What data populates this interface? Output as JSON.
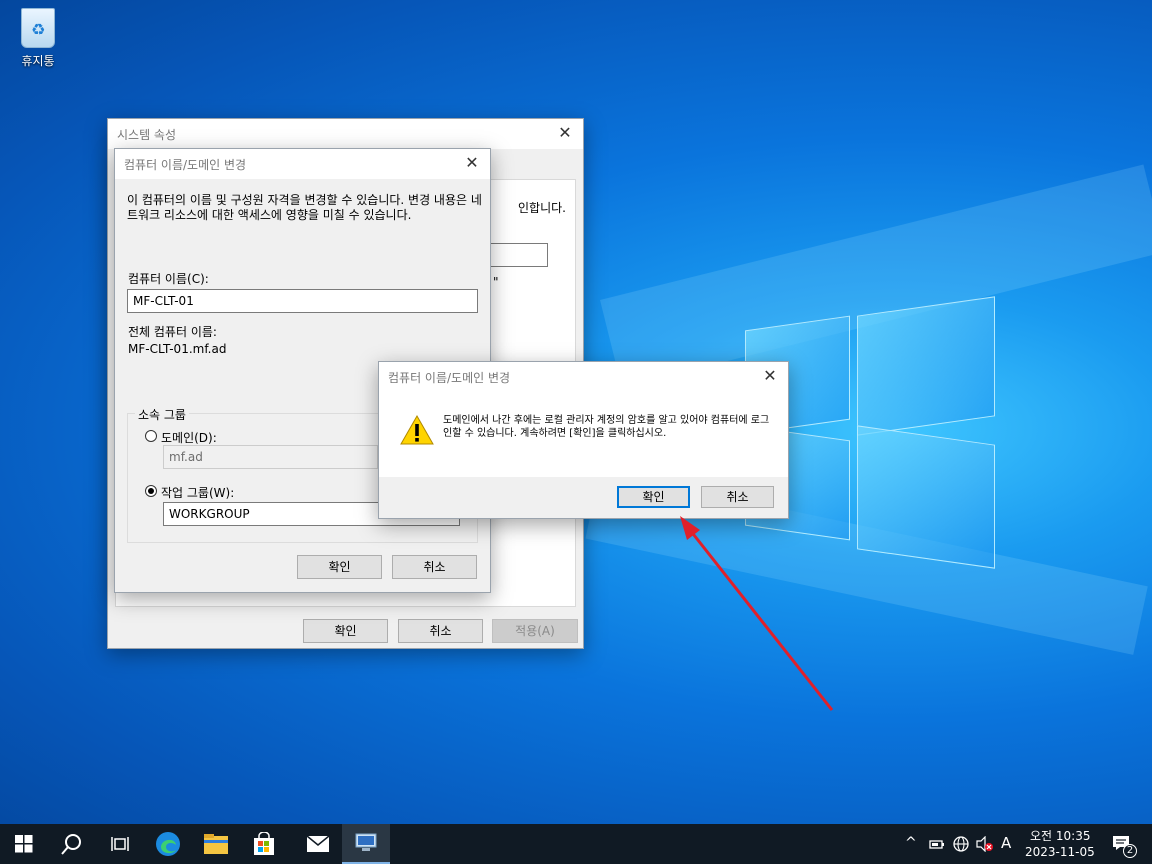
{
  "desktop": {
    "recycle_bin_label": "휴지통"
  },
  "sysprops": {
    "title": "시스템 속성",
    "partial_text_1": "인합니다.",
    "partial_text_2": "\"",
    "ok": "확인",
    "cancel": "취소",
    "apply": "적용(A)"
  },
  "rename": {
    "title": "컴퓨터 이름/도메인 변경",
    "description": "이 컴퓨터의 이름 및 구성원 자격을 변경할 수 있습니다. 변경 내용은 네트워크 리소스에 대한 액세스에 영향을 미칠 수 있습니다.",
    "computer_name_label": "컴퓨터 이름(C):",
    "computer_name_value": "MF-CLT-01",
    "full_name_label": "전체 컴퓨터 이름:",
    "full_name_value": "MF-CLT-01.mf.ad",
    "member_of_label": "소속 그룹",
    "domain_label": "도메인(D):",
    "domain_value": "mf.ad",
    "workgroup_label": "작업 그룹(W):",
    "workgroup_value": "WORKGROUP",
    "ok": "확인",
    "cancel": "취소"
  },
  "alert": {
    "title": "컴퓨터 이름/도메인 변경",
    "message": "도메인에서 나간 후에는 로컬 관리자 계정의 암호를 알고 있어야 컴퓨터에 로그인할 수 있습니다. 계속하려면 [확인]을 클릭하십시오.",
    "ok": "확인",
    "cancel": "취소"
  },
  "taskbar": {
    "ime": "A",
    "time": "오전 10:35",
    "date": "2023-11-05",
    "notification_count": "2"
  },
  "colors": {
    "accent": "#0078d7",
    "arrow": "#e0202a",
    "taskbar": "#101a24"
  }
}
